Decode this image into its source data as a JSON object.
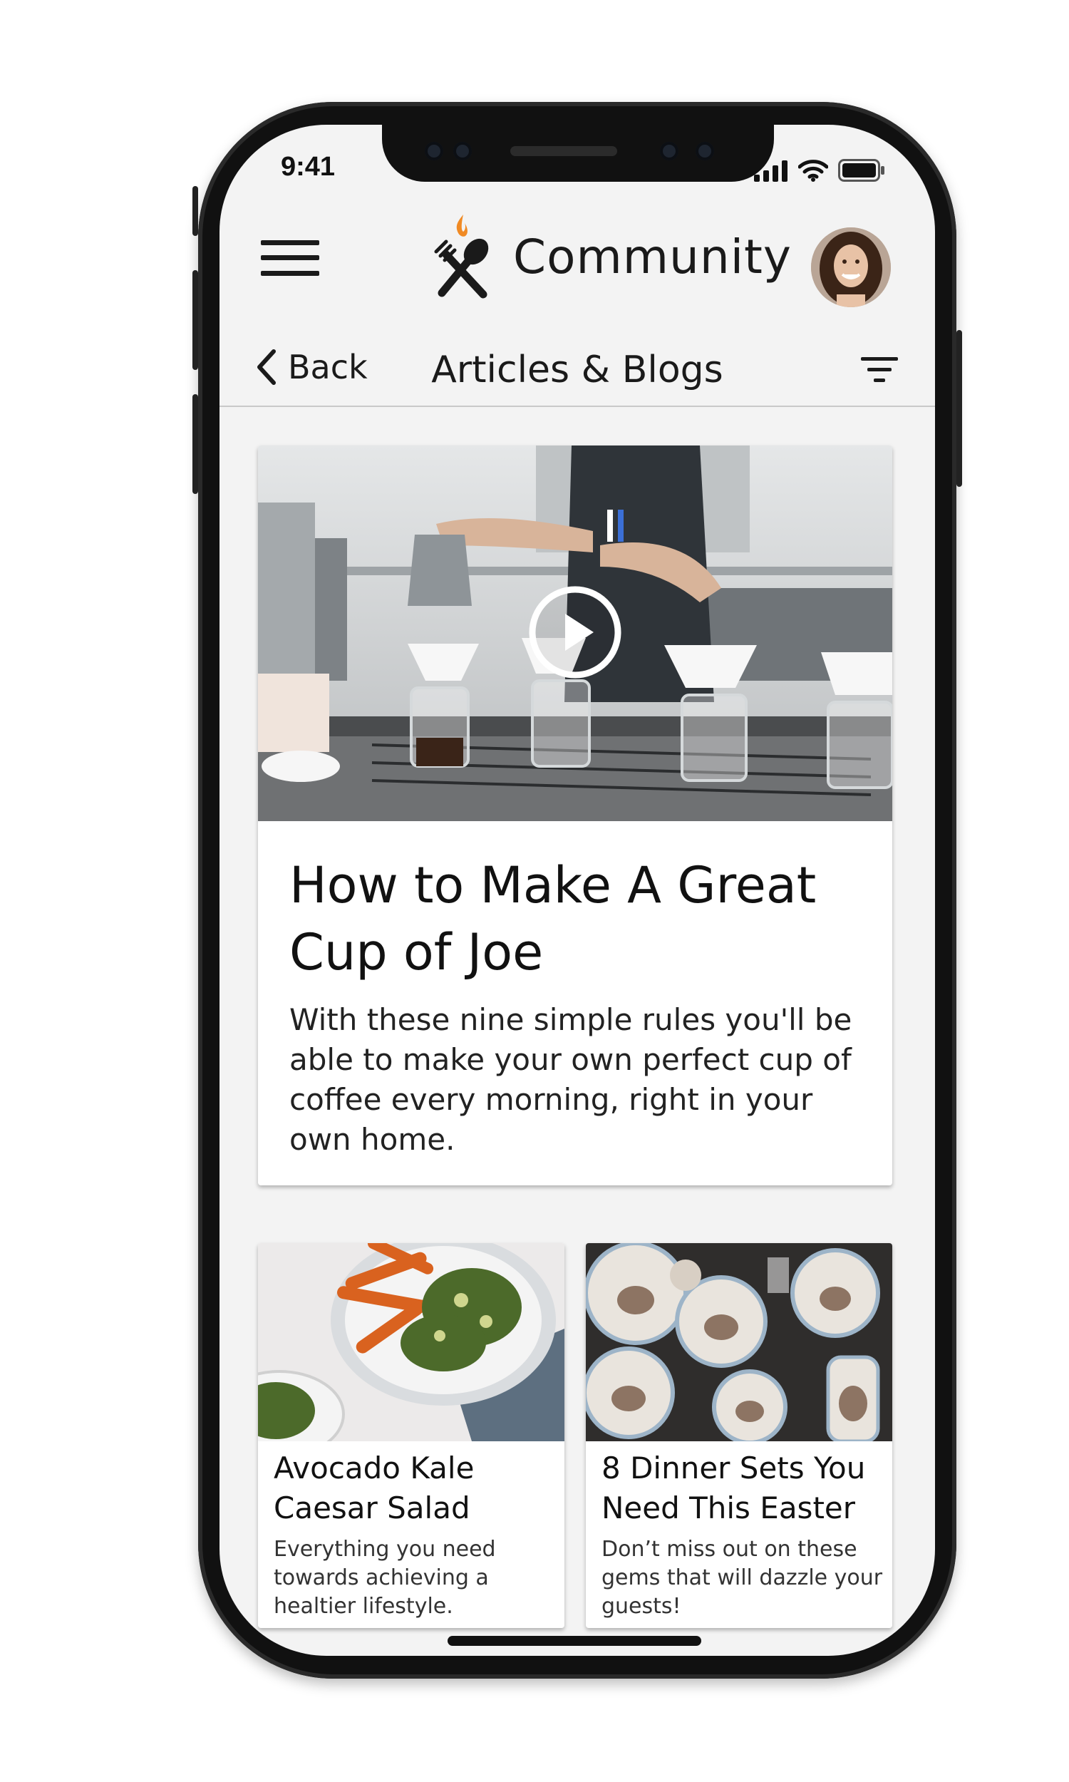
{
  "status_bar": {
    "time": "9:41",
    "icons": [
      "signal-icon",
      "wifi-icon",
      "battery-icon"
    ]
  },
  "header": {
    "menu_icon": "hamburger-menu-icon",
    "logo_icon": "fork-spoon-flame-icon",
    "title": "Community",
    "avatar_icon": "user-avatar"
  },
  "subheader": {
    "back_label": "Back",
    "title": "Articles & Blogs",
    "filter_icon": "filter-icon"
  },
  "featured": {
    "image": "barista-pour-over-coffee-photo",
    "play_icon": "play-icon",
    "title": "How to Make A Great Cup of Joe",
    "description": "With these nine simple rules you'll be able to make your own perfect cup of coffee every morning, right in your own home."
  },
  "cards": [
    {
      "image": "kale-salad-sweet-potato-photo",
      "title": "Avocado Kale Caesar Salad",
      "description": "Everything you need towards achieving a healtier lifestyle."
    },
    {
      "image": "bunny-dinnerware-photo",
      "title": "8 Dinner Sets You Need This Easter",
      "description": "Don’t miss out on these gems that will dazzle your guests!"
    }
  ],
  "colors": {
    "screen_bg": "#f3f3f3",
    "text": "#1a1a1a",
    "logo_flame": "#f08a24",
    "logo_utensil": "#1a1a1a"
  }
}
